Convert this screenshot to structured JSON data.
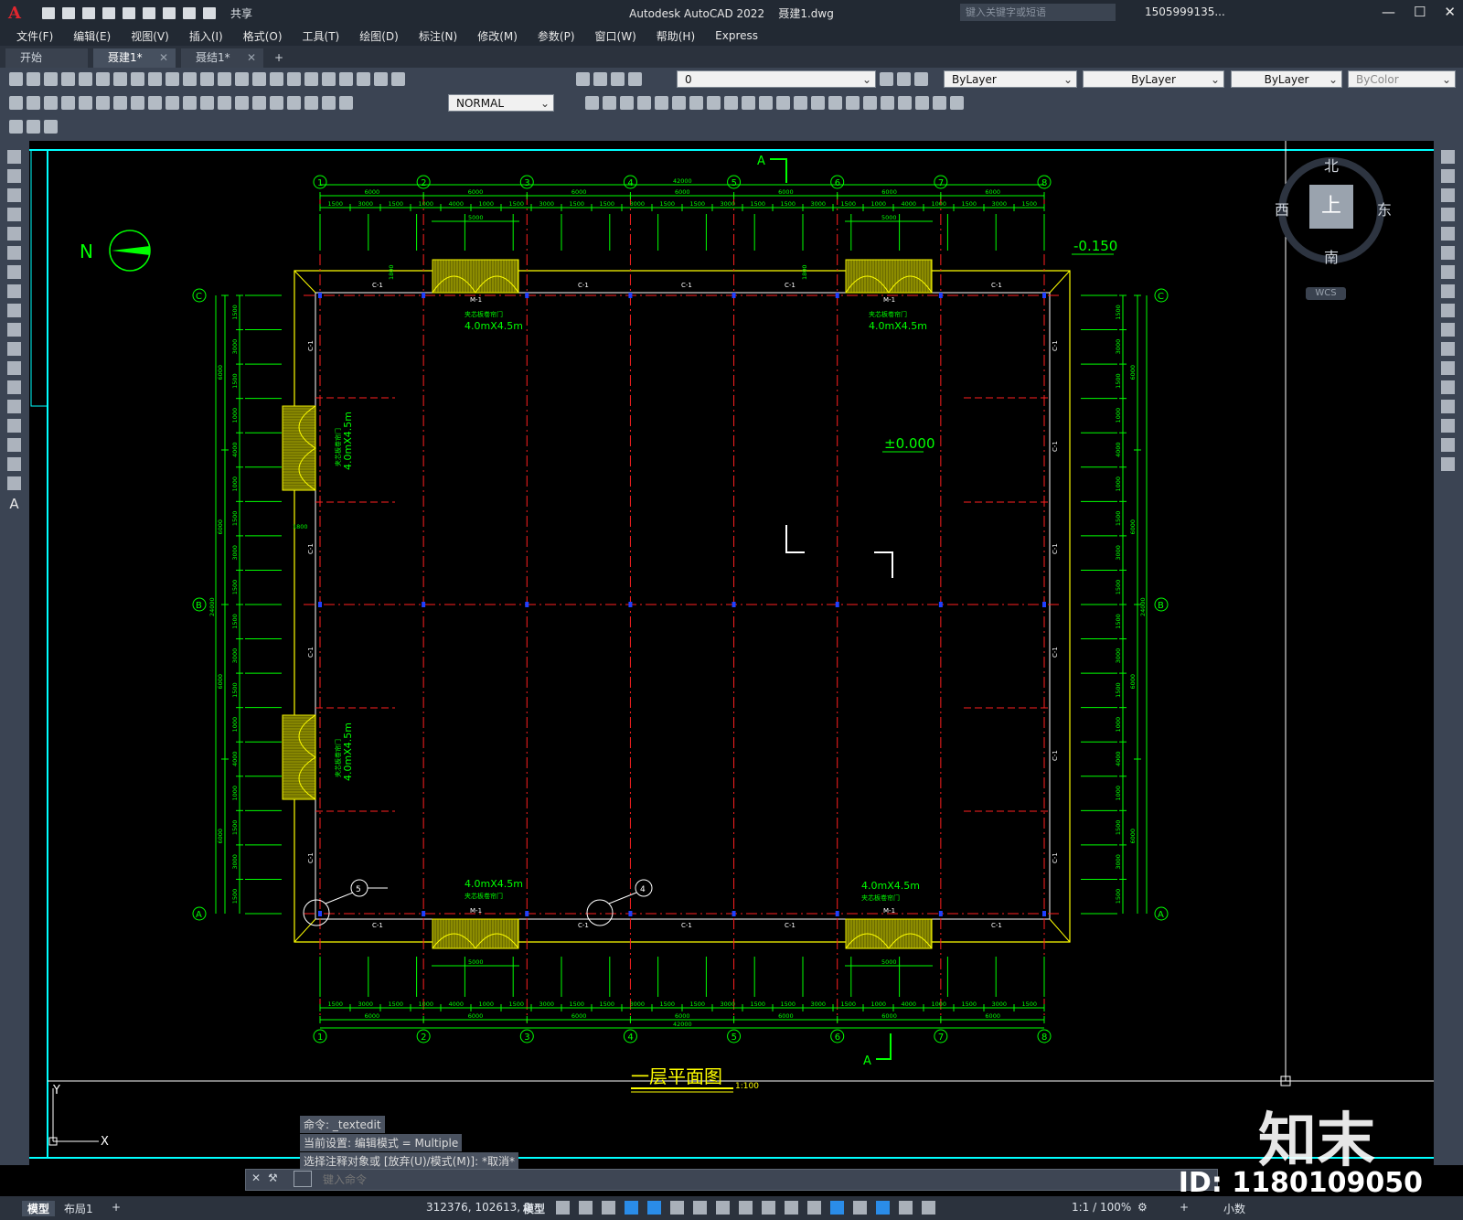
{
  "app": {
    "logo": "A",
    "title": "Autodesk AutoCAD 2022",
    "filename": "聂建1.dwg",
    "share_label": "共享",
    "search_placeholder": "键入关键字或短语",
    "user": "1505999135...",
    "window_controls": [
      "—",
      "☐",
      "✕"
    ]
  },
  "menu": [
    "文件(F)",
    "编辑(E)",
    "视图(V)",
    "插入(I)",
    "格式(O)",
    "工具(T)",
    "绘图(D)",
    "标注(N)",
    "修改(M)",
    "参数(P)",
    "窗口(W)",
    "帮助(H)",
    "Express"
  ],
  "tabs": [
    {
      "label": "开始",
      "closable": false,
      "active": false
    },
    {
      "label": "聂建1*",
      "closable": true,
      "active": true
    },
    {
      "label": "聂结1*",
      "closable": true,
      "active": false
    }
  ],
  "toolbar": {
    "layer_value": "0",
    "color_value": "ByLayer",
    "linetype_value": "ByLayer",
    "lineweight_value": "ByLayer",
    "plotstyle_value": "ByColor",
    "dimstyle_value": "NORMAL"
  },
  "viewcube": {
    "north": "北",
    "south": "南",
    "east": "东",
    "west": "西",
    "top": "上",
    "wcs": "WCS"
  },
  "drawing": {
    "grid_cols": [
      "1",
      "2",
      "3",
      "4",
      "5",
      "6",
      "7",
      "8"
    ],
    "grid_rows": [
      "C",
      "B",
      "A"
    ],
    "bay_dims": [
      "6000",
      "6000",
      "6000",
      "6000",
      "6000",
      "6000",
      "6000"
    ],
    "total_dim": "42000",
    "side_total": "24000",
    "sub_dims_top": [
      "1500",
      "3000",
      "1500",
      "1000",
      "4000",
      "1000",
      "1500",
      "3000",
      "1500",
      "1500",
      "3000",
      "1500",
      "1500",
      "3000",
      "1500",
      "1500",
      "3000",
      "1500",
      "1000",
      "4000",
      "1000",
      "1500",
      "3000",
      "1500"
    ],
    "door_width": "5000",
    "window_label": "C-1",
    "door_label": "M-1",
    "door_name": "夹芯板卷帘门",
    "door_size": "4.0mX4.5m",
    "elev_outside": "-0.150",
    "elev_inside": "±0.000",
    "section_mark": "A",
    "north_label": "N",
    "title": "一层平面图",
    "scale": "1:100",
    "detail_5": "5",
    "detail_4": "4",
    "small_dim_1800": "1800",
    "side_dims": [
      "1500",
      "3000",
      "1500",
      "1000",
      "4000",
      "1000",
      "1500",
      "3000",
      "1500",
      "1500",
      "3000",
      "1500",
      "1000",
      "4000",
      "1000",
      "1500",
      "3000",
      "1500"
    ],
    "side_bays": [
      "6000",
      "6000",
      "6000",
      "6000"
    ]
  },
  "command": {
    "history": [
      "命令: _textedit",
      "当前设置: 编辑模式 = Multiple",
      "选择注释对象或 [放弃(U)/模式(M)]: *取消*"
    ],
    "placeholder": "键入命令"
  },
  "status": {
    "coords": "312376, 102613, 0",
    "model_label": "模型",
    "scale": "1:1 / 100%",
    "units": "小数"
  },
  "layout_tabs": [
    "模型",
    "布局1"
  ],
  "watermark": {
    "brand": "知末",
    "id": "ID: 1180109050"
  }
}
